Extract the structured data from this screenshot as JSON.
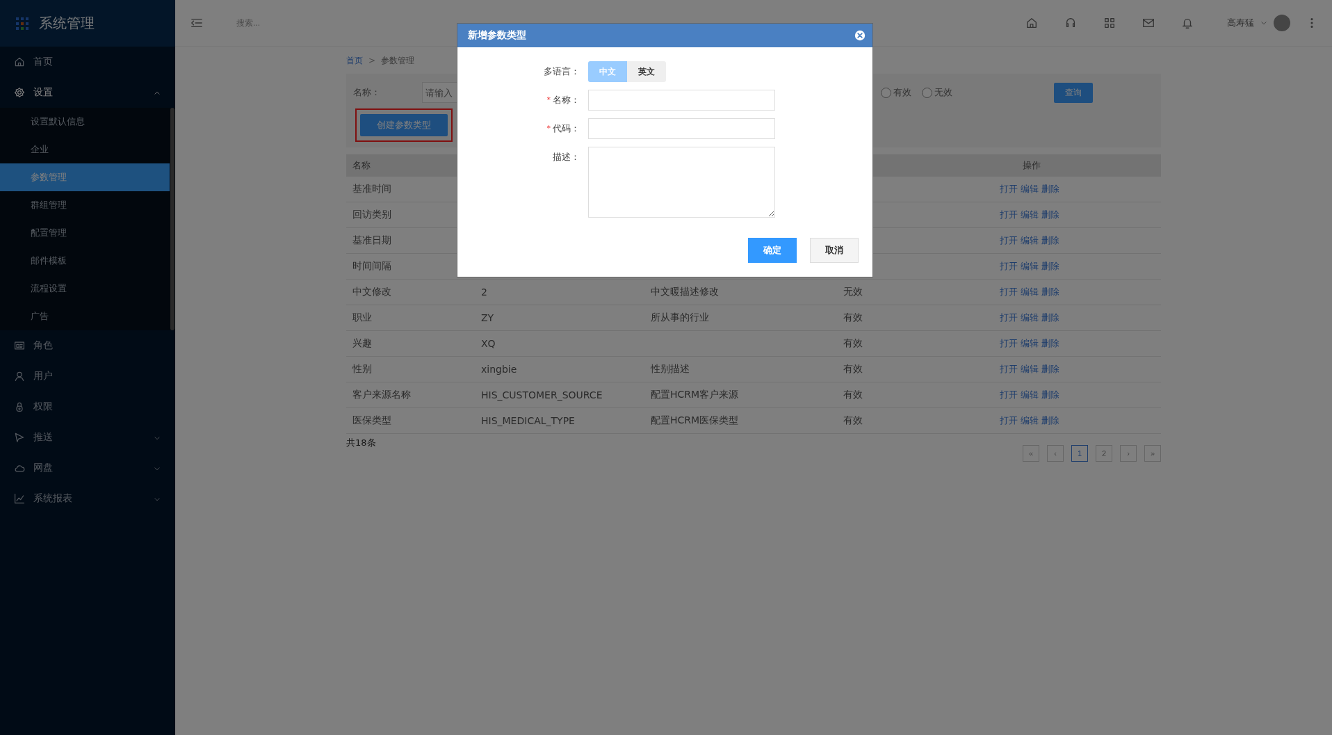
{
  "app": {
    "title": "系统管理"
  },
  "sidebar": {
    "items": [
      {
        "label": "首页",
        "kind": "home",
        "expanded": false,
        "selected": false
      },
      {
        "label": "设置",
        "kind": "gear",
        "expanded": true,
        "selected": false,
        "children": [
          {
            "label": "设置默认信息",
            "selected": false
          },
          {
            "label": "企业",
            "selected": false
          },
          {
            "label": "参数管理",
            "selected": true
          },
          {
            "label": "群组管理",
            "selected": false
          },
          {
            "label": "配置管理",
            "selected": false
          },
          {
            "label": "邮件模板",
            "selected": false
          },
          {
            "label": "流程设置",
            "selected": false
          },
          {
            "label": "广告",
            "selected": false
          }
        ]
      },
      {
        "label": "角色",
        "kind": "card",
        "expanded": false,
        "selected": false
      },
      {
        "label": "用户",
        "kind": "user",
        "expanded": false,
        "selected": false
      },
      {
        "label": "权限",
        "kind": "lock",
        "expanded": false,
        "selected": false
      },
      {
        "label": "推送",
        "kind": "send",
        "expanded": false,
        "selected": false,
        "has_children": true
      },
      {
        "label": "网盘",
        "kind": "cloud",
        "expanded": false,
        "selected": false,
        "has_children": true
      },
      {
        "label": "系统报表",
        "kind": "chart",
        "expanded": false,
        "selected": false,
        "has_children": true
      }
    ]
  },
  "topbar": {
    "search": {
      "placeholder": "搜索..."
    },
    "user": "高寿猛"
  },
  "breadcrumb": {
    "items": [
      "首页",
      "参数管理"
    ],
    "separator": ">"
  },
  "filter": {
    "name_label": "名称：",
    "name_placeholder": "请输入",
    "radios": [
      {
        "label": "有效",
        "selected": false
      },
      {
        "label": "无效",
        "selected": false
      }
    ],
    "query_button": "查询",
    "create_button": "创建参数类型",
    "create_highlighted": true
  },
  "table": {
    "columns": [
      "名称",
      "操作"
    ],
    "rows": [
      {
        "name": "基准时间",
        "actions": [
          "打开",
          "编辑",
          "删除"
        ]
      },
      {
        "name": "回访类别",
        "actions": [
          "打开",
          "编辑",
          "删除"
        ]
      },
      {
        "name": "基准日期",
        "actions": [
          "打开",
          "编辑",
          "删除"
        ]
      },
      {
        "name": "时间间隔",
        "actions": [
          "打开",
          "编辑",
          "删除"
        ]
      },
      {
        "name": "中文修改",
        "code": "2",
        "description": "中文暖描述修改",
        "status": "无效",
        "actions": [
          "打开",
          "编辑",
          "删除"
        ]
      },
      {
        "name": "职业",
        "code": "ZY",
        "description": "所从事的行业",
        "status": "有效",
        "actions": [
          "打开",
          "编辑",
          "删除"
        ]
      },
      {
        "name": "兴趣",
        "code": "XQ",
        "status": "有效",
        "actions": [
          "打开",
          "编辑",
          "删除"
        ]
      },
      {
        "name": "性别",
        "code": "xingbie",
        "description": "性别描述",
        "status": "有效",
        "actions": [
          "打开",
          "编辑",
          "删除"
        ]
      },
      {
        "name": "客户来源名称",
        "code": "HIS_CUSTOMER_SOURCE",
        "description": "配置HCRM客户来源",
        "status": "有效",
        "actions": [
          "打开",
          "编辑",
          "删除"
        ]
      },
      {
        "name": "医保类型",
        "code": "HIS_MEDICAL_TYPE",
        "description": "配置HCRM医保类型",
        "status": "有效",
        "actions": [
          "打开",
          "编辑",
          "删除"
        ]
      }
    ],
    "total": "共18条"
  },
  "pagination": [
    {
      "label": "«",
      "selected": false
    },
    {
      "label": "‹",
      "selected": false
    },
    {
      "label": "1",
      "selected": true
    },
    {
      "label": "2",
      "selected": false
    },
    {
      "label": "›",
      "selected": false
    },
    {
      "label": "»",
      "selected": false
    }
  ],
  "dialog": {
    "title": "新增参数类型",
    "required_mark": "*",
    "language": {
      "label": "多语言：",
      "options": [
        {
          "label": "中文",
          "selected": true
        },
        {
          "label": "英文",
          "selected": false
        }
      ]
    },
    "fields": [
      {
        "label": "名称：",
        "required": true,
        "kind": "input"
      },
      {
        "label": "代码：",
        "required": true,
        "kind": "input"
      },
      {
        "label": "描述：",
        "required": false,
        "kind": "textarea"
      }
    ],
    "buttons": [
      {
        "label": "确定",
        "kind": "primary"
      },
      {
        "label": "取消",
        "kind": "default"
      }
    ]
  }
}
